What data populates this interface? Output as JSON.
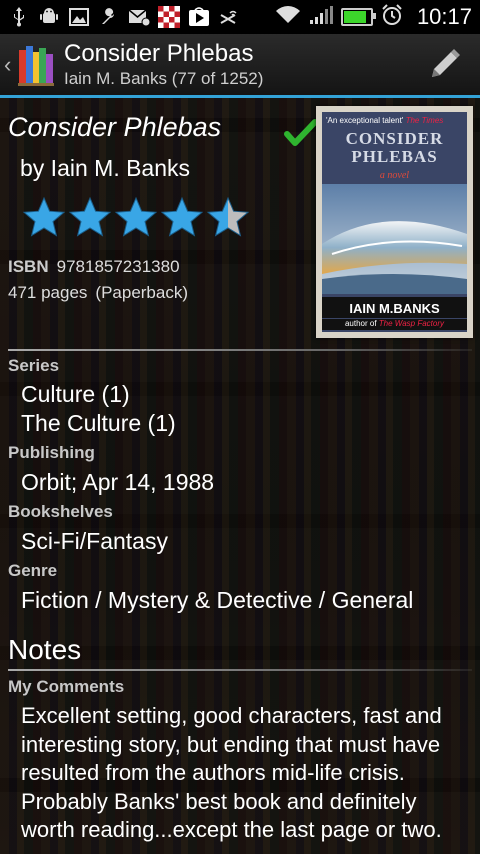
{
  "status_bar": {
    "time": "10:17",
    "battery_level": 0.9,
    "icons": [
      "usb-icon",
      "android-debug-icon",
      "image-icon",
      "wrench-icon",
      "mail-icon",
      "checkerboard-app-icon",
      "play-store-icon",
      "wireless-off-icon",
      "wifi-icon",
      "signal-icon",
      "battery-icon",
      "alarm-icon"
    ]
  },
  "action_bar": {
    "title": "Consider Phlebas",
    "subtitle": "Iain M. Banks (77 of 1252)",
    "accent": "#33a3d8"
  },
  "book": {
    "title": "Consider Phlebas",
    "author_line": "by Iain M. Banks",
    "rating": 4.5,
    "rating_max": 5,
    "read": true,
    "isbn_label": "ISBN",
    "isbn": "9781857231380",
    "pages": "471 pages",
    "format": "(Paperback)",
    "cover": {
      "quote": "'An exceptional talent' ",
      "quote_source": "The Times",
      "title_lines": [
        "CONSIDER",
        "PHLEBAS"
      ],
      "tagline": "a novel",
      "author": "IAIN M.BANKS",
      "author_of": "author of ",
      "author_of_book": "The Wasp Factory"
    }
  },
  "sections": {
    "series_label": "Series",
    "series": [
      "Culture (1)",
      "The Culture (1)"
    ],
    "publishing_label": "Publishing",
    "publishing": "Orbit; Apr 14, 1988",
    "bookshelves_label": "Bookshelves",
    "bookshelves": "Sci-Fi/Fantasy",
    "genre_label": "Genre",
    "genre": "Fiction / Mystery & Detective / General"
  },
  "notes": {
    "heading": "Notes",
    "comments_label": "My Comments",
    "comments": "Excellent setting, good characters, fast and interesting story, but ending that must have resulted from the authors mid-life crisis. Probably Banks' best book and definitely worth reading...except the last page or two."
  },
  "colors": {
    "star_fill": "#39a6e6",
    "star_empty": "#bdbdbd",
    "check": "#2fb42f"
  }
}
